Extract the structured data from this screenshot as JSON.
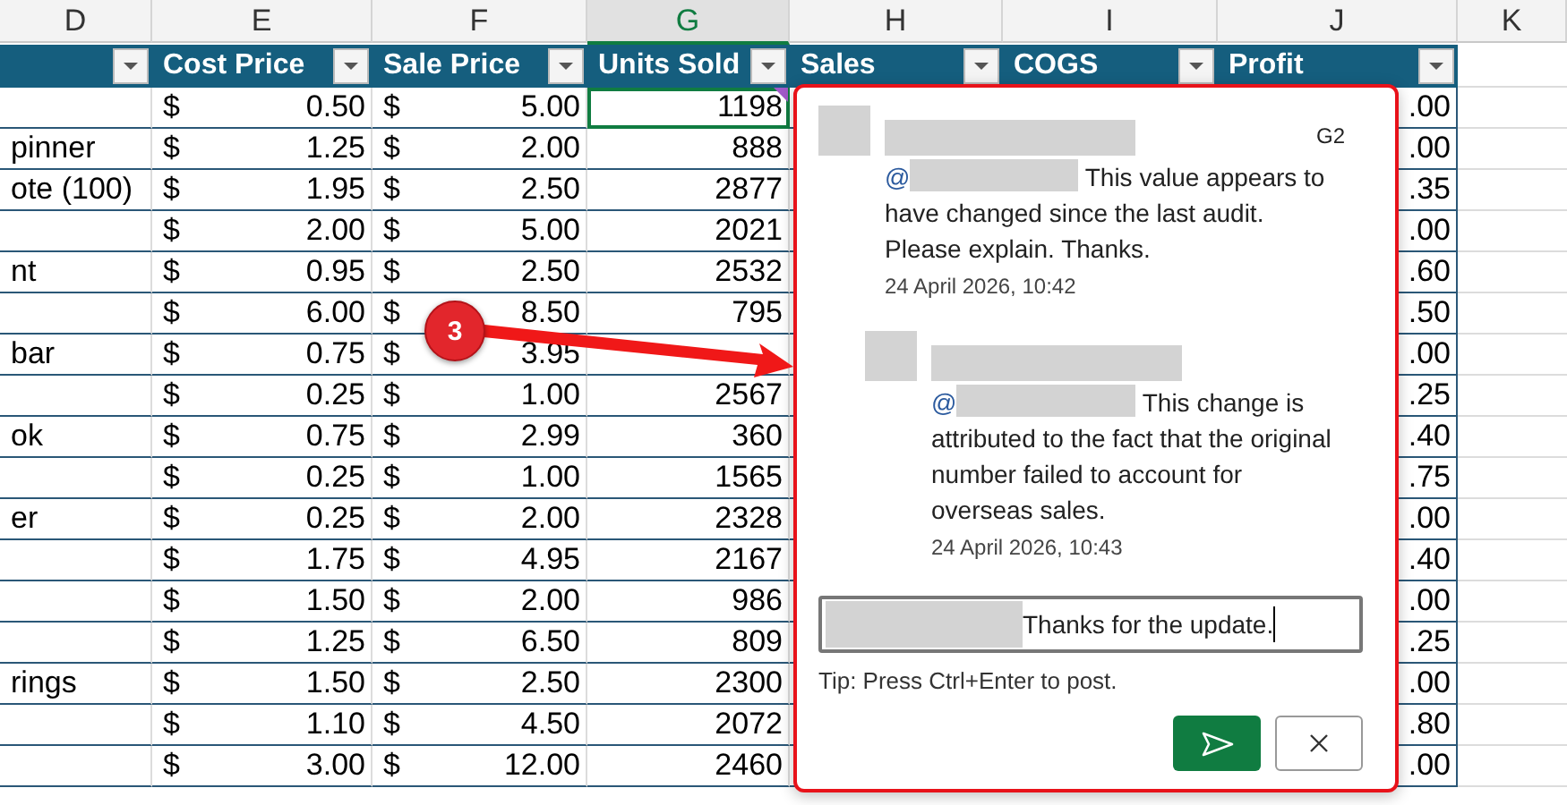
{
  "column_letters": [
    {
      "label": "D",
      "selected": false
    },
    {
      "label": "E",
      "selected": false
    },
    {
      "label": "F",
      "selected": false
    },
    {
      "label": "G",
      "selected": true
    },
    {
      "label": "H",
      "selected": false
    },
    {
      "label": "I",
      "selected": false
    },
    {
      "label": "J",
      "selected": false
    },
    {
      "label": "K",
      "selected": false
    }
  ],
  "table": {
    "columns": [
      "Cost Price",
      "Sale Price",
      "Units Sold",
      "Sales",
      "COGS",
      "Profit"
    ],
    "rows": [
      {
        "cost": [
          "$",
          "0.50"
        ],
        "sale": [
          "$",
          "5.00"
        ],
        "units": "1198",
        "profit": ".00",
        "selected": true,
        "has_comment": true
      },
      {
        "item": "pinner",
        "cost": [
          "$",
          "1.25"
        ],
        "sale": [
          "$",
          "2.00"
        ],
        "units": "888",
        "profit": ".00",
        "selected": false,
        "has_comment": false
      },
      {
        "item": "ote (100)",
        "cost": [
          "$",
          "1.95"
        ],
        "sale": [
          "$",
          "2.50"
        ],
        "units": "2877",
        "profit": ".35",
        "selected": false,
        "has_comment": false
      },
      {
        "cost": [
          "$",
          "2.00"
        ],
        "sale": [
          "$",
          "5.00"
        ],
        "units": "2021",
        "profit": ".00",
        "selected": false,
        "has_comment": false
      },
      {
        "item": "nt",
        "cost": [
          "$",
          "0.95"
        ],
        "sale": [
          "$",
          "2.50"
        ],
        "units": "2532",
        "profit": ".60",
        "selected": false,
        "has_comment": false
      },
      {
        "cost": [
          "$",
          "6.00"
        ],
        "sale": [
          "$",
          "8.50"
        ],
        "units": "795",
        "profit": ".50",
        "selected": false,
        "has_comment": false
      },
      {
        "item": "bar",
        "cost": [
          "$",
          "0.75"
        ],
        "sale": [
          "$",
          "3.95"
        ],
        "profit": ".00",
        "selected": false,
        "has_comment": false
      },
      {
        "cost": [
          "$",
          "0.25"
        ],
        "sale": [
          "$",
          "1.00"
        ],
        "units": "2567",
        "profit": ".25",
        "selected": false,
        "has_comment": false
      },
      {
        "item": "ok",
        "cost": [
          "$",
          "0.75"
        ],
        "sale": [
          "$",
          "2.99"
        ],
        "units": "360",
        "profit": ".40",
        "selected": false,
        "has_comment": false
      },
      {
        "cost": [
          "$",
          "0.25"
        ],
        "sale": [
          "$",
          "1.00"
        ],
        "units": "1565",
        "profit": ".75",
        "selected": false,
        "has_comment": false
      },
      {
        "item": "er",
        "cost": [
          "$",
          "0.25"
        ],
        "sale": [
          "$",
          "2.00"
        ],
        "units": "2328",
        "profit": ".00",
        "selected": false,
        "has_comment": false
      },
      {
        "cost": [
          "$",
          "1.75"
        ],
        "sale": [
          "$",
          "4.95"
        ],
        "units": "2167",
        "profit": ".40",
        "selected": false,
        "has_comment": false
      },
      {
        "cost": [
          "$",
          "1.50"
        ],
        "sale": [
          "$",
          "2.00"
        ],
        "units": "986",
        "profit": ".00",
        "selected": false,
        "has_comment": false
      },
      {
        "cost": [
          "$",
          "1.25"
        ],
        "sale": [
          "$",
          "6.50"
        ],
        "units": "809",
        "profit": ".25",
        "selected": false,
        "has_comment": false
      },
      {
        "item": "rings",
        "cost": [
          "$",
          "1.50"
        ],
        "sale": [
          "$",
          "2.50"
        ],
        "units": "2300",
        "profit": ".00",
        "selected": false,
        "has_comment": false
      },
      {
        "cost": [
          "$",
          "1.10"
        ],
        "sale": [
          "$",
          "4.50"
        ],
        "units": "2072",
        "profit": ".80",
        "selected": false,
        "has_comment": false
      },
      {
        "cost": [
          "$",
          "3.00"
        ],
        "sale": [
          "$",
          "12.00"
        ],
        "units": "2460",
        "profit": ".00",
        "selected": false,
        "has_comment": false
      }
    ]
  },
  "comment_thread": {
    "cell": "G2",
    "comments": [
      {
        "kind": "original",
        "mention": "@",
        "text": "This value appears to have changed since the last audit. Please explain. Thanks.",
        "time": "24 April 2026, 10:42"
      },
      {
        "kind": "reply",
        "mention": "@",
        "text": "This change is attributed to the fact that the original number failed to account for overseas sales.",
        "time": "24 April 2026, 10:43"
      }
    ],
    "draft": {
      "value": "Thanks for the update."
    },
    "tip": "Tip: Press Ctrl+Enter to post."
  },
  "annotation": {
    "label": "3"
  }
}
